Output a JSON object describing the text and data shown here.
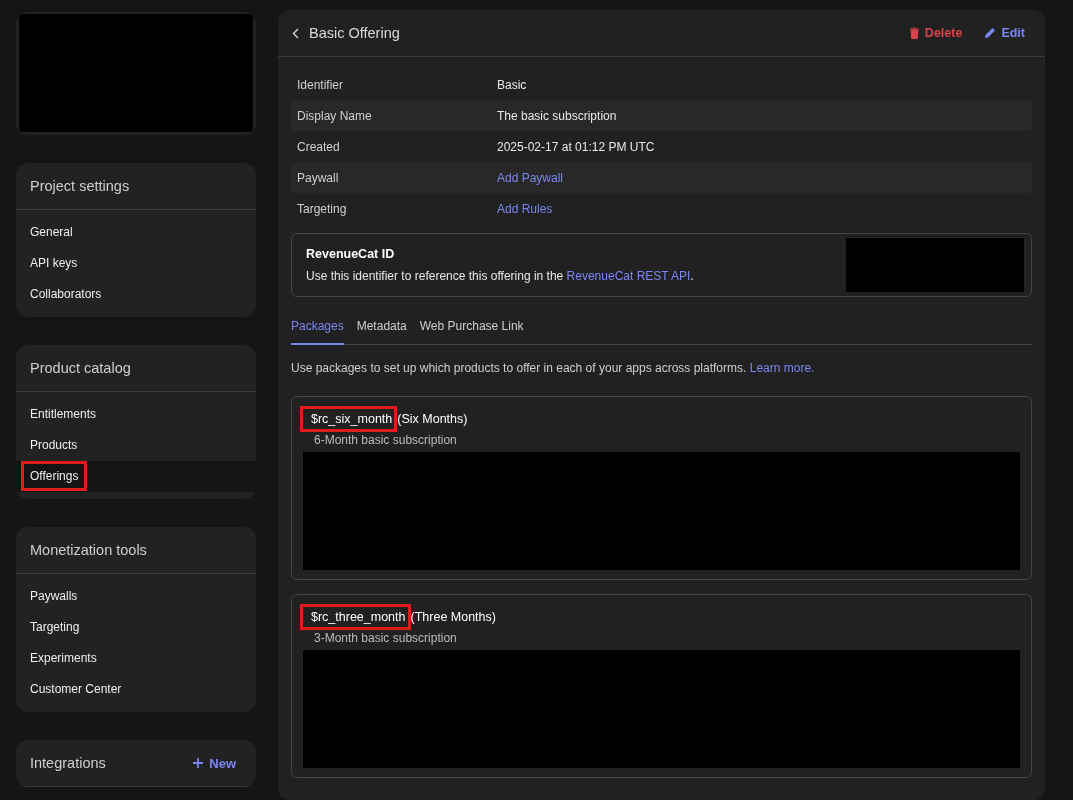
{
  "sidebar": {
    "sections": [
      {
        "title": "Project settings",
        "items": [
          {
            "label": "General",
            "selected": false,
            "highlighted": false
          },
          {
            "label": "API keys",
            "selected": false,
            "highlighted": false
          },
          {
            "label": "Collaborators",
            "selected": false,
            "highlighted": false
          }
        ]
      },
      {
        "title": "Product catalog",
        "items": [
          {
            "label": "Entitlements",
            "selected": false,
            "highlighted": false
          },
          {
            "label": "Products",
            "selected": false,
            "highlighted": false
          },
          {
            "label": "Offerings",
            "selected": true,
            "highlighted": true
          }
        ]
      },
      {
        "title": "Monetization tools",
        "items": [
          {
            "label": "Paywalls",
            "selected": false,
            "highlighted": false
          },
          {
            "label": "Targeting",
            "selected": false,
            "highlighted": false
          },
          {
            "label": "Experiments",
            "selected": false,
            "highlighted": false
          },
          {
            "label": "Customer Center",
            "selected": false,
            "highlighted": false
          }
        ]
      },
      {
        "title": "Integrations",
        "action": "New"
      }
    ]
  },
  "offering": {
    "title": "Basic Offering",
    "actions": [
      {
        "kind": "delete",
        "label": "Delete"
      },
      {
        "kind": "edit",
        "label": "Edit"
      }
    ],
    "details": [
      {
        "label": "Identifier",
        "value": "Basic",
        "kind": "text"
      },
      {
        "label": "Display Name",
        "value": "The basic subscription",
        "kind": "text"
      },
      {
        "label": "Created",
        "value": "2025-02-17 at 01:12 PM UTC",
        "kind": "text"
      },
      {
        "label": "Paywall",
        "value": "Add Paywall",
        "kind": "link"
      },
      {
        "label": "Targeting",
        "value": "Add Rules",
        "kind": "link"
      }
    ],
    "id_card": {
      "title": "RevenueCat ID",
      "text": "Use this identifier to reference this offering in the ",
      "link": "RevenueCat REST API",
      "suffix": "."
    },
    "tabs": [
      {
        "label": "Packages",
        "selected": true
      },
      {
        "label": "Metadata",
        "selected": false
      },
      {
        "label": "Web Purchase Link",
        "selected": false
      }
    ],
    "description": "Use packages to set up which products to offer in each of your apps across platforms.",
    "learn_more": "Learn more.",
    "packages": [
      {
        "identifier": "$rc_six_month",
        "name": "(Six Months)",
        "description": "6-Month basic subscription",
        "highlighted": true
      },
      {
        "identifier": "$rc_three_month",
        "name": "(Three Months)",
        "description": "3-Month basic subscription",
        "highlighted": true
      }
    ]
  }
}
